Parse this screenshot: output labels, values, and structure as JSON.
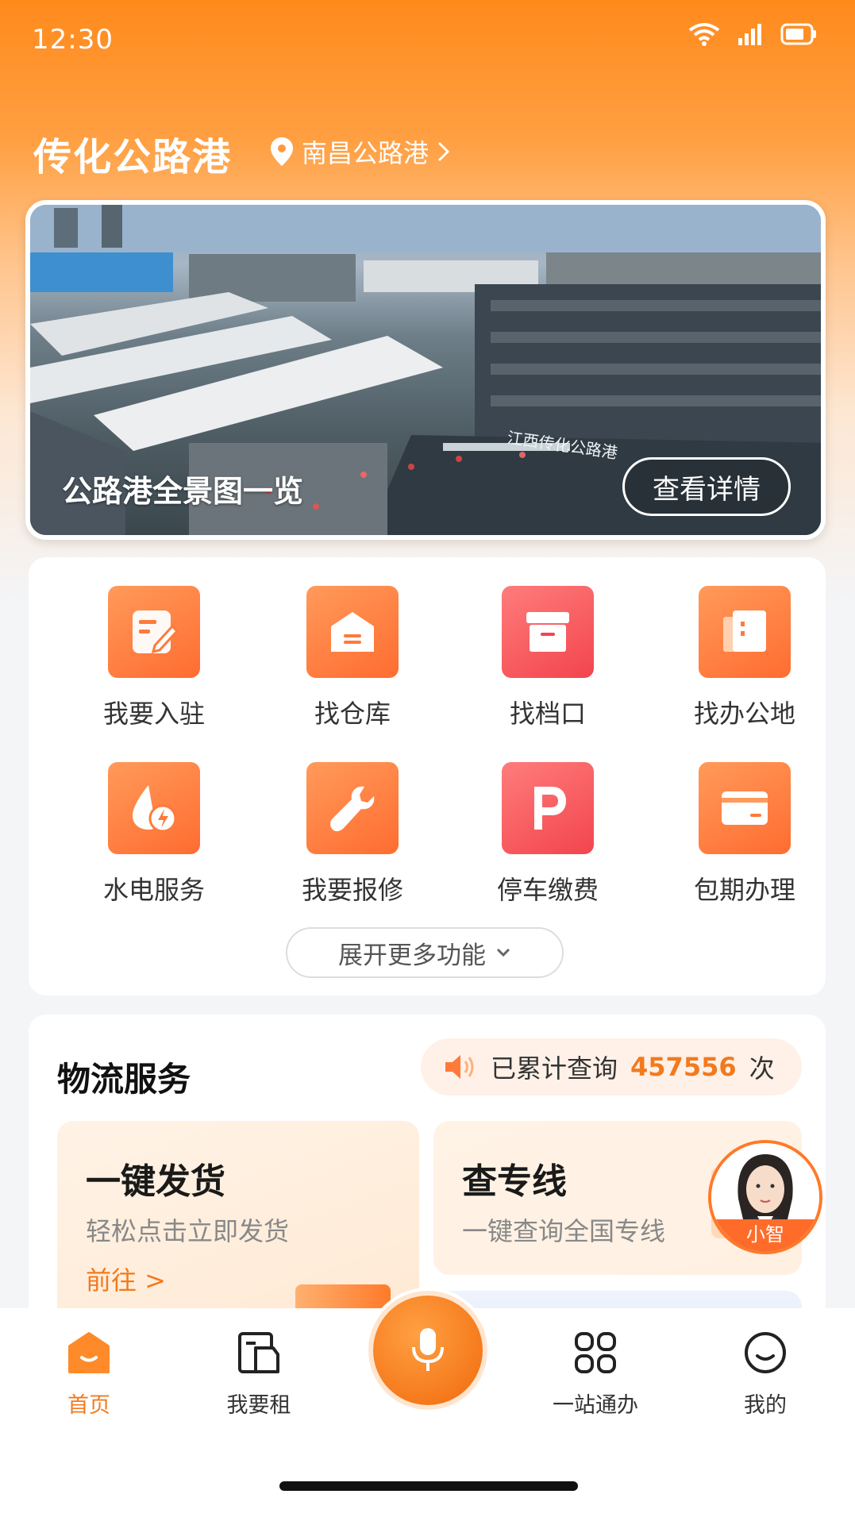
{
  "status_bar": {
    "time": "12:30"
  },
  "header": {
    "brand": "传化公路港",
    "location": "南昌公路港"
  },
  "banner": {
    "title": "公路港全景图一览",
    "button": "查看详情",
    "sign_text": "江西传化公路港"
  },
  "functions": {
    "items": [
      {
        "label": "我要入驻",
        "icon": "edit-icon"
      },
      {
        "label": "找仓库",
        "icon": "warehouse-icon"
      },
      {
        "label": "找档口",
        "icon": "box-icon"
      },
      {
        "label": "找办公地",
        "icon": "office-icon"
      },
      {
        "label": "水电服务",
        "icon": "water-electric-icon"
      },
      {
        "label": "我要报修",
        "icon": "wrench-icon"
      },
      {
        "label": "停车缴费",
        "icon": "parking-icon"
      },
      {
        "label": "包期办理",
        "icon": "card-icon"
      }
    ],
    "expand_label": "展开更多功能"
  },
  "logistics": {
    "title": "物流服务",
    "query_prefix": "已累计查询",
    "query_count": "457556",
    "query_suffix": "次",
    "services": [
      {
        "title": "一键发货",
        "subtitle": "轻松点击立即发货",
        "action": "前往 >"
      },
      {
        "title": "查专线",
        "subtitle": "一键查询全国专线"
      }
    ]
  },
  "assistant": {
    "name": "小智"
  },
  "tabbar": {
    "items": [
      {
        "label": "首页",
        "active": true
      },
      {
        "label": "我要租"
      },
      {
        "label": "一站通办"
      },
      {
        "label": "我的"
      }
    ]
  },
  "colors": {
    "accent": "#f27a1e",
    "brand_orange": "#ff8a1c",
    "icon_red": "#f2454d"
  }
}
